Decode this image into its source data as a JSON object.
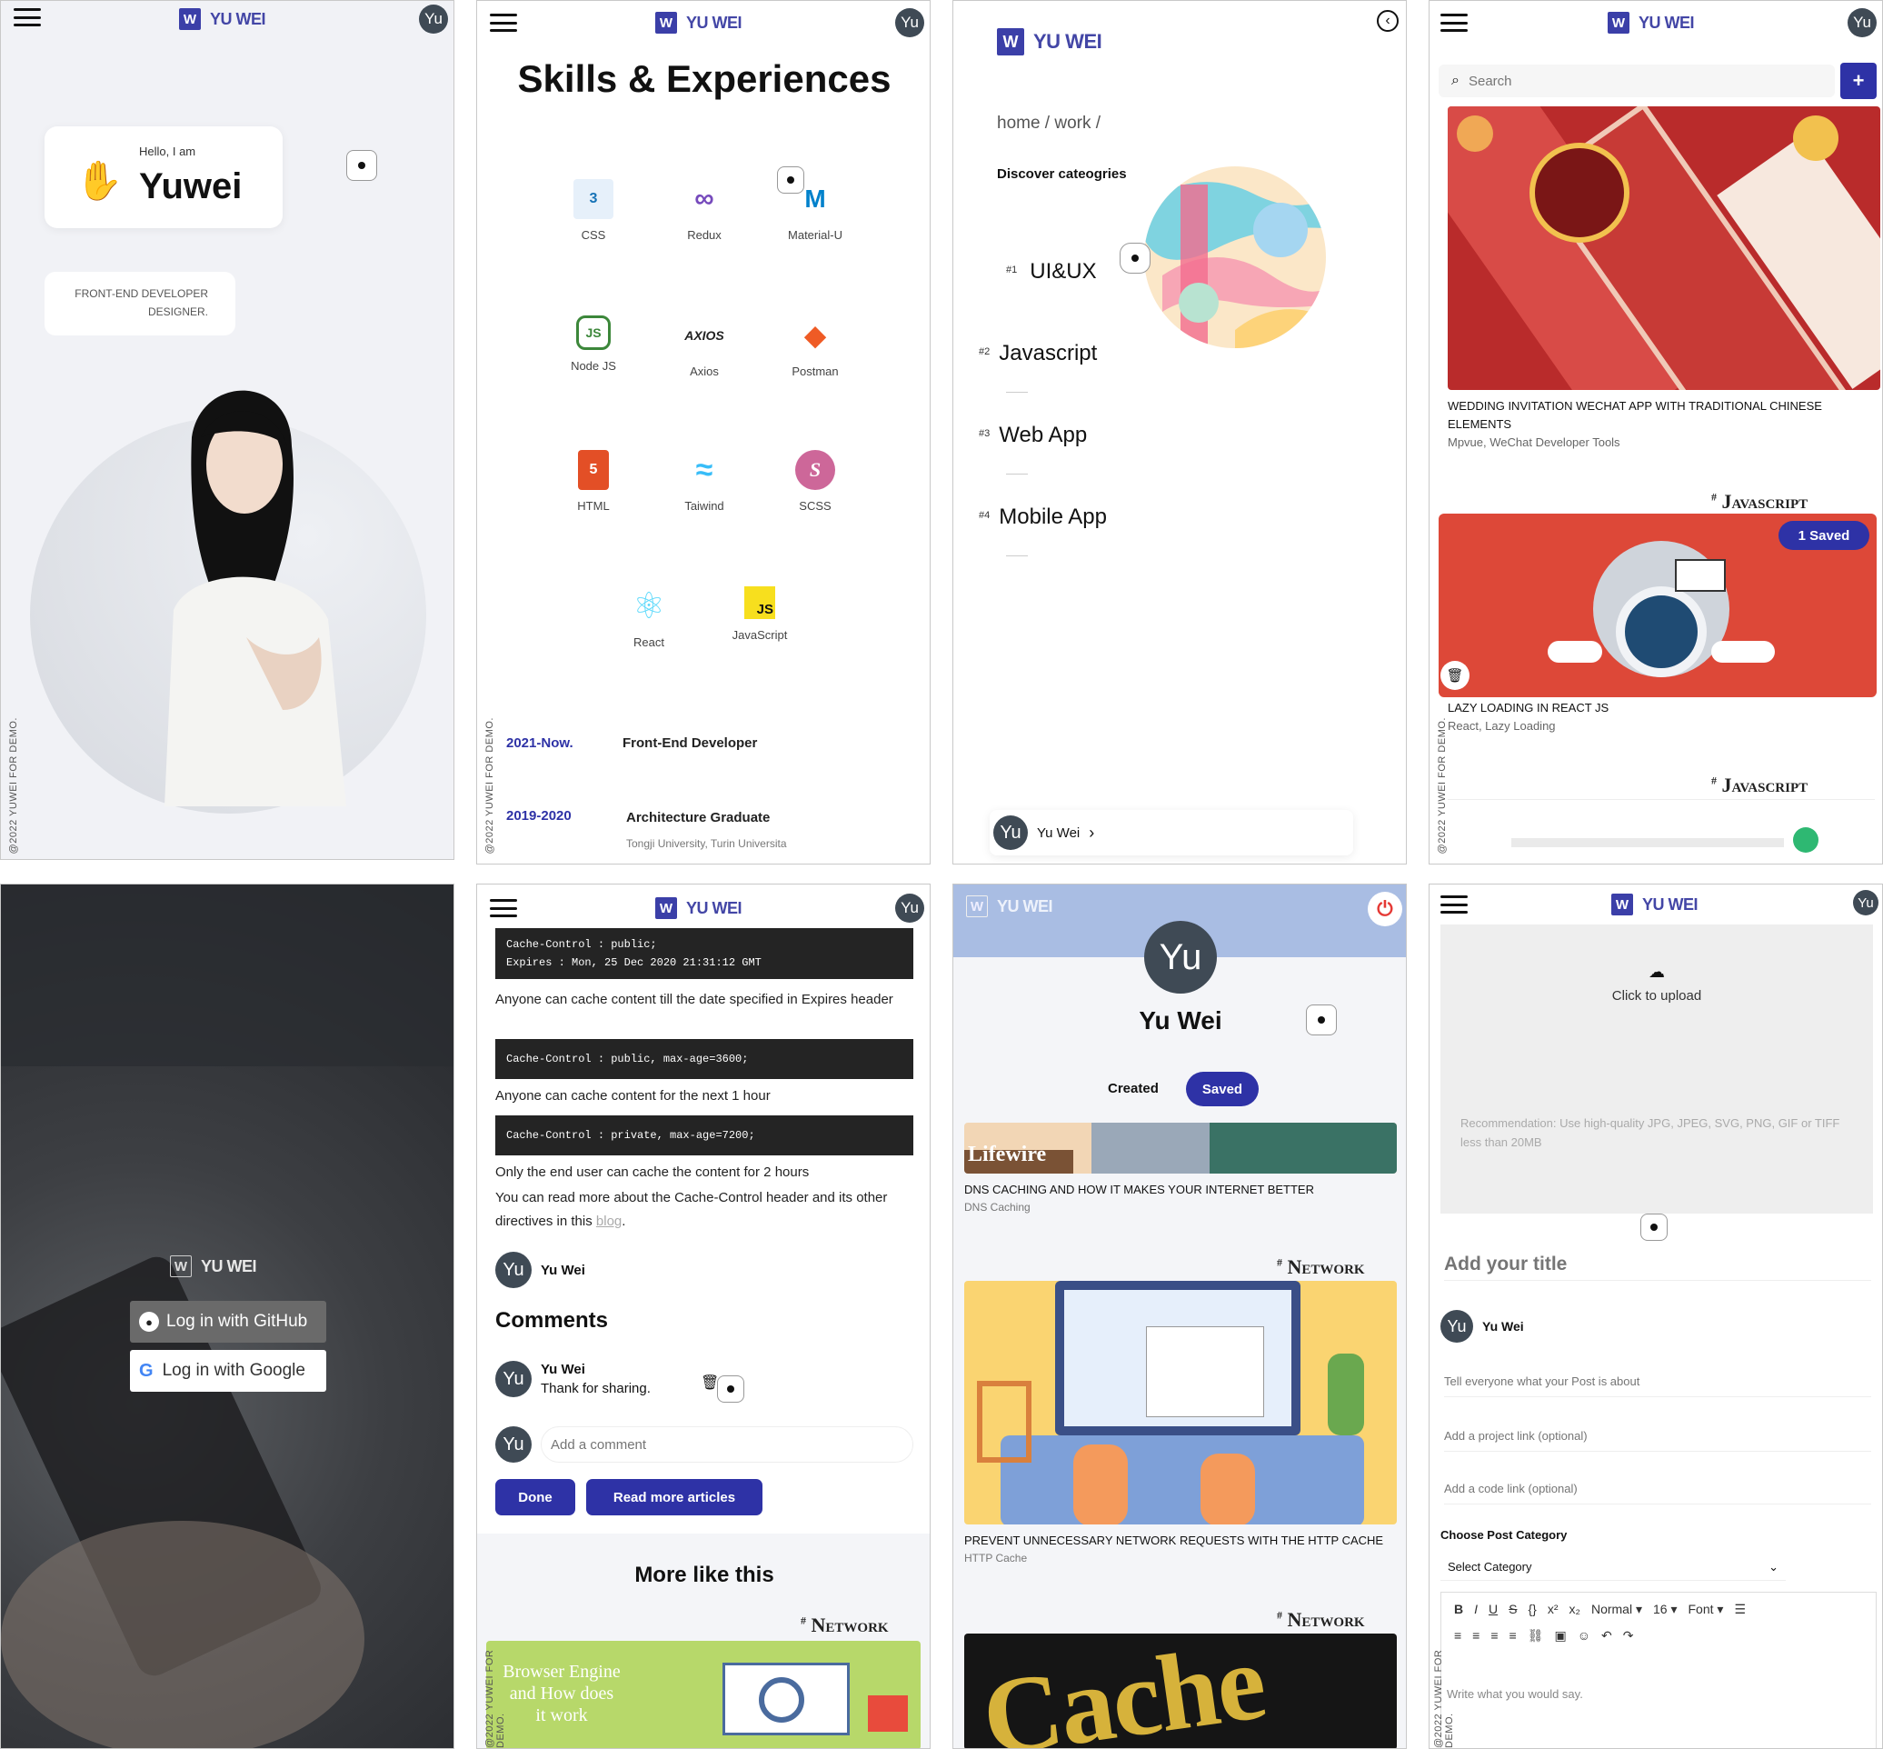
{
  "brand": {
    "name": "YU WEI",
    "mark": "W",
    "avatar_initials": "Yu"
  },
  "copyright": "@2022 YUWEI FOR DEMO.",
  "hero": {
    "greeting": "Hello, I am",
    "name": "Yuwei",
    "role_line1": "FRONT-END DEVELOPER",
    "role_line2": "DESIGNER."
  },
  "skills": {
    "title": "Skills & Experiences",
    "items": [
      {
        "label": "CSS",
        "glyph": "3",
        "color": "#1572B6"
      },
      {
        "label": "Redux",
        "glyph": "∞",
        "color": "#764ABC"
      },
      {
        "label": "Material-U",
        "glyph": "M",
        "color": "#0081CB"
      },
      {
        "label": "Node JS",
        "glyph": "JS",
        "color": "#3C873A"
      },
      {
        "label": "Axios",
        "glyph": "AXIOS",
        "color": "#222222"
      },
      {
        "label": "Postman",
        "glyph": "◆",
        "color": "#EF5B25"
      },
      {
        "label": "HTML",
        "glyph": "5",
        "color": "#E34F26"
      },
      {
        "label": "Taiwind",
        "glyph": "≈",
        "color": "#38BDF8"
      },
      {
        "label": "SCSS",
        "glyph": "S",
        "color": "#CD6799"
      },
      {
        "label": "React",
        "glyph": "⚛",
        "color": "#61DAFB"
      },
      {
        "label": "JavaScript",
        "glyph": "JS",
        "color": "#F7DF1E"
      }
    ],
    "experience": [
      {
        "years": "2021-Now.",
        "title": "Front-End Developer",
        "sub": ""
      },
      {
        "years": "2019-2020",
        "title": "Architecture Graduate",
        "sub": "Tongji University, Turin Universita"
      }
    ]
  },
  "menu": {
    "breadcrumb": "home / work /",
    "discover": "Discover cateogries",
    "categories": [
      {
        "num": "#1",
        "label": "UI&UX"
      },
      {
        "num": "#2",
        "label": "Javascript"
      },
      {
        "num": "#3",
        "label": "Web App"
      },
      {
        "num": "#4",
        "label": "Mobile App"
      }
    ],
    "user": "Yu Wei",
    "user_chevron": "›"
  },
  "feed": {
    "search_placeholder": "Search",
    "add_label": "+",
    "posts": [
      {
        "title": "WEDDING INVITATION WECHAT APP WITH TRADITIONAL CHINESE ELEMENTS",
        "tags": "Mpvue, WeChat Developer Tools"
      },
      {
        "title": "LAZY LOADING IN REACT JS",
        "tags": "React, Lazy Loading"
      }
    ],
    "tag": "Javascript",
    "saved_badge": "1 Saved"
  },
  "login": {
    "github": "Log in with GitHub",
    "google": "Log in with Google"
  },
  "article": {
    "code1_line1": "Cache-Control : public;",
    "code1_line2": "Expires : Mon, 25 Dec 2020 21:31:12 GMT",
    "text1": "Anyone can cache content till the date specified in Expires header",
    "code2": "Cache-Control : public, max-age=3600;",
    "text2": "Anyone can cache content for the next 1 hour",
    "code3": "Cache-Control : private, max-age=7200;",
    "text3": "Only the end user can cache the content for 2 hours",
    "text4": "You can read more about the Cache-Control header and its other directives in this",
    "link": "blog",
    "period": ".",
    "author": "Yu Wei",
    "comments_title": "Comments",
    "comment_author": "Yu Wei",
    "comment_text": "Thank for sharing.",
    "comment_placeholder": "Add a comment",
    "done": "Done",
    "read_more": "Read more articles",
    "more_like": "More like this",
    "tag": "Network",
    "banner_text": "Browser Engine and How does it work"
  },
  "profile": {
    "name": "Yu Wei",
    "tab_created": "Created",
    "tab_saved": "Saved",
    "posts": [
      {
        "title": "DNS CACHING AND HOW IT MAKES YOUR INTERNET BETTER",
        "tags": "DNS Caching",
        "banner": "Lifewire"
      },
      {
        "title": "PREVENT UNNECESSARY NETWORK REQUESTS WITH THE HTTP CACHE",
        "tags": "HTTP Cache"
      }
    ],
    "tag": "Network",
    "cache_text": "Cache"
  },
  "create": {
    "upload": "Click to upload",
    "recommend": "Recommendation: Use high-quality JPG, JPEG, SVG, PNG, GIF or TIFF less than 20MB",
    "title_placeholder": "Add your title",
    "author": "Yu Wei",
    "about_placeholder": "Tell everyone what your Post is about",
    "project_placeholder": "Add a project link (optional)",
    "code_placeholder": "Add a code link (optional)",
    "category_label": "Choose Post Category",
    "category_value": "Select Category",
    "toolbar": {
      "paragraph": "Normal",
      "size": "16",
      "font": "Font"
    },
    "editor_placeholder": "Write what you would say."
  }
}
